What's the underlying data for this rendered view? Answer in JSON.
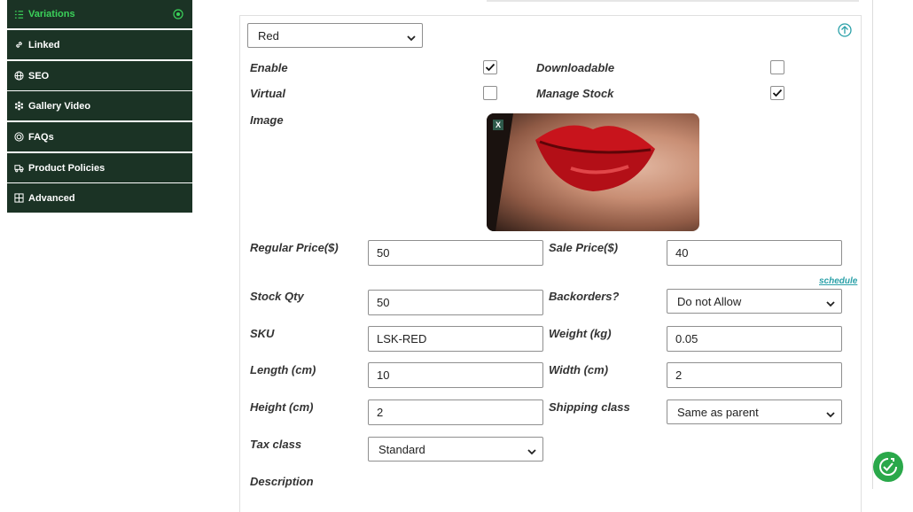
{
  "sidebar": {
    "items": [
      {
        "label": "Variations",
        "icon": "list-icon",
        "active": true
      },
      {
        "label": "Linked",
        "icon": "link-icon"
      },
      {
        "label": "SEO",
        "icon": "globe-icon"
      },
      {
        "label": "Gallery Video",
        "icon": "gallery-icon"
      },
      {
        "label": "FAQs",
        "icon": "faq-icon"
      },
      {
        "label": "Product Policies",
        "icon": "truck-icon"
      },
      {
        "label": "Advanced",
        "icon": "grid-icon"
      }
    ],
    "active_color": "#3bd25a",
    "bg_color": "#1b3325"
  },
  "variation": {
    "attribute_value": "Red",
    "enable_label": "Enable",
    "enable_checked": true,
    "downloadable_label": "Downloadable",
    "downloadable_checked": false,
    "virtual_label": "Virtual",
    "virtual_checked": false,
    "manage_stock_label": "Manage Stock",
    "manage_stock_checked": true,
    "image_label": "Image",
    "image_remove": "X",
    "regular_price_label": "Regular Price($)",
    "regular_price": "50",
    "sale_price_label": "Sale Price($)",
    "sale_price": "40",
    "schedule_link": "schedule",
    "stock_qty_label": "Stock Qty",
    "stock_qty": "50",
    "backorders_label": "Backorders?",
    "backorders_value": "Do not Allow",
    "sku_label": "SKU",
    "sku": "LSK-RED",
    "weight_label": "Weight (kg)",
    "weight": "0.05",
    "length_label": "Length (cm)",
    "length": "10",
    "width_label": "Width (cm)",
    "width": "2",
    "height_label": "Height (cm)",
    "height": "2",
    "shipping_class_label": "Shipping class",
    "shipping_class_value": "Same as parent",
    "tax_class_label": "Tax class",
    "tax_class_value": "Standard",
    "description_label": "Description"
  },
  "accent_color": "#2aa0a8",
  "fab_color": "#2aa84a"
}
